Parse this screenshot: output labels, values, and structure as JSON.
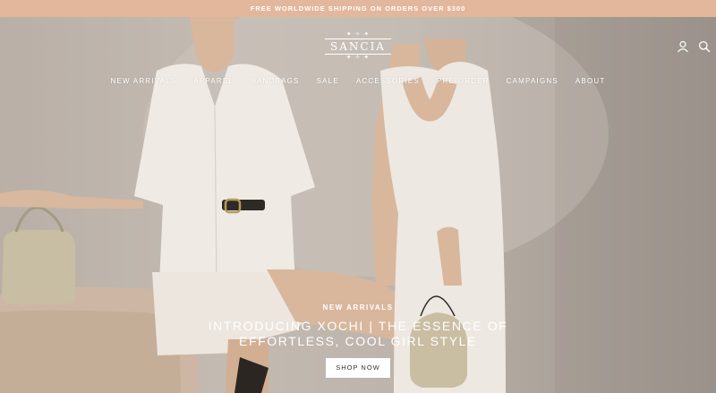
{
  "announcement": {
    "text": "FREE WORLDWIDE SHIPPING ON ORDERS OVER $300"
  },
  "brand": {
    "logo_text": "SANCIA"
  },
  "colors": {
    "announcement_bg": "#e2b79c",
    "text": "#ffffff",
    "button_bg": "#ffffff",
    "button_text": "#333333"
  },
  "header": {
    "icons": [
      "account-icon",
      "search-icon"
    ]
  },
  "nav": {
    "items": [
      {
        "label": "NEW ARRIVALS"
      },
      {
        "label": "APPAREL"
      },
      {
        "label": "HANDBAGS"
      },
      {
        "label": "SALE"
      },
      {
        "label": "ACCESSORIES"
      },
      {
        "label": "PRE-ORDER"
      },
      {
        "label": "CAMPAIGNS"
      },
      {
        "label": "ABOUT"
      }
    ]
  },
  "hero": {
    "eyebrow": "NEW ARRIVALS",
    "headline_line1": "INTRODUCING XOCHI | THE ESSENCE OF",
    "headline_line2": "EFFORTLESS, COOL GIRL STYLE",
    "cta_label": "SHOP NOW"
  }
}
